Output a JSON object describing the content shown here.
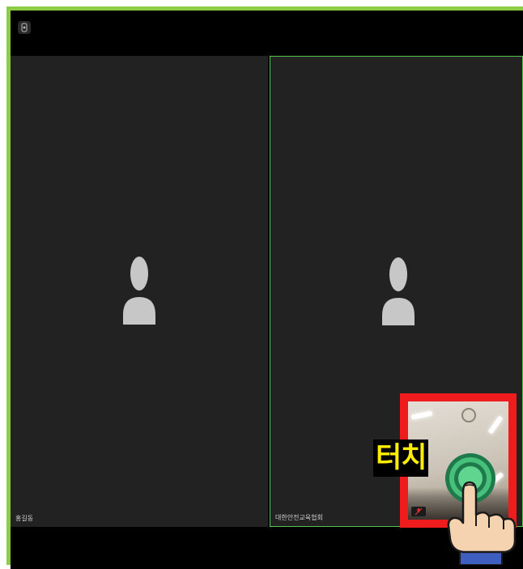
{
  "meeting": {
    "participants": [
      {
        "name": "홍길동",
        "active_speaker": false
      },
      {
        "name": "대한안전교육협회",
        "active_speaker": true
      }
    ]
  },
  "annotation": {
    "touch_label": "터치"
  },
  "colors": {
    "outer_border": "#8dcc45",
    "active_speaker_border": "#55c24c",
    "highlight_border": "#ee1c1c",
    "label_text": "#ffee00",
    "tile_bg": "#222222"
  },
  "icons": {
    "top_left": "camera-switch-icon",
    "avatar": "person-silhouette-icon",
    "self_view_audio": "mic-muted-icon",
    "touch": "touch-ripple-icon",
    "pointer": "pointing-hand-icon"
  }
}
